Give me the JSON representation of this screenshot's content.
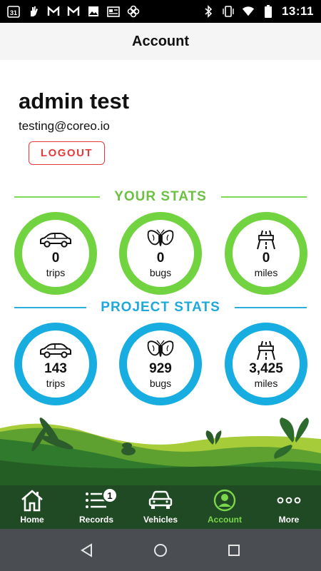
{
  "status_bar": {
    "time": "13:11",
    "left_icons": [
      "calendar-icon",
      "hand-icon",
      "gmail-icon",
      "gmail-icon",
      "photo-icon",
      "news-icon",
      "pinwheel-icon"
    ],
    "right_icons": [
      "bluetooth-icon",
      "vibrate-icon",
      "wifi-icon",
      "battery-icon"
    ],
    "calendar_day": "31"
  },
  "header": {
    "title": "Account"
  },
  "profile": {
    "name": "admin test",
    "email": "testing@coreo.io",
    "logout_label": "LOGOUT"
  },
  "your_stats": {
    "title": "YOUR STATS",
    "color": "#72d340",
    "items": [
      {
        "icon": "car-icon",
        "value": "0",
        "label": "trips"
      },
      {
        "icon": "moth-icon",
        "value": "0",
        "label": "bugs"
      },
      {
        "icon": "road-icon",
        "value": "0",
        "label": "miles"
      }
    ]
  },
  "project_stats": {
    "title": "PROJECT STATS",
    "color": "#18ade0",
    "items": [
      {
        "icon": "car-icon",
        "value": "143",
        "label": "trips"
      },
      {
        "icon": "moth-icon",
        "value": "929",
        "label": "bugs"
      },
      {
        "icon": "road-icon",
        "value": "3,425",
        "label": "miles"
      }
    ]
  },
  "bottom_nav": {
    "items": [
      {
        "icon": "home-icon",
        "label": "Home",
        "active": false
      },
      {
        "icon": "records-list-icon",
        "label": "Records",
        "active": false,
        "badge": "1"
      },
      {
        "icon": "vehicle-icon",
        "label": "Vehicles",
        "active": false
      },
      {
        "icon": "account-icon",
        "label": "Account",
        "active": true
      },
      {
        "icon": "more-dots-icon",
        "label": "More",
        "active": false
      }
    ]
  },
  "android_nav": [
    "back-icon",
    "home-circle-icon",
    "recents-icon"
  ]
}
